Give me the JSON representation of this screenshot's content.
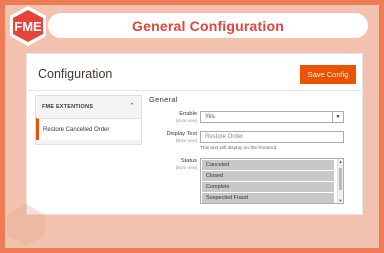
{
  "header": {
    "title": "General Configuration"
  },
  "config": {
    "page_title": "Configuration",
    "save_label": "Save Config",
    "sidebar": {
      "section_label": "FME EXTENTIONS",
      "items": [
        {
          "label": "Restore Cancelled Order"
        }
      ]
    },
    "section_title": "General",
    "fields": {
      "enable": {
        "label": "Enable",
        "scope": "[store view]",
        "value": "Yes"
      },
      "display_text": {
        "label": "Display Text",
        "scope": "[store view]",
        "placeholder": "Restore Order",
        "note": "This text will display on the frontend."
      },
      "status": {
        "label": "Status",
        "scope": "[store view]",
        "options": [
          "Canceled",
          "Closed",
          "Complete",
          "Suspected Fraud"
        ]
      }
    }
  },
  "colors": {
    "accent": "#eb5202",
    "brand": "#ed7b56",
    "title": "#e4443a"
  },
  "icons": {
    "logo": "fme-logo-icon",
    "collapse": "chevron-up-icon",
    "dropdown": "caret-down-icon"
  }
}
